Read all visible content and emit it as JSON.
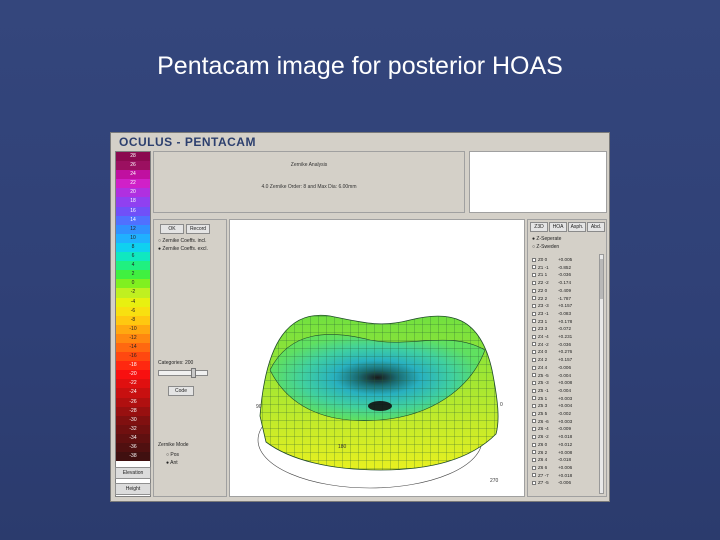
{
  "slide": {
    "title": "Pentacam image for posterior HOAS"
  },
  "app": {
    "title": "OCULUS - PENTACAM",
    "header_line1": "Zernike Analysis",
    "header_line2": "4.0 Zernike Order: 8 and Max Dia: 6.00mm",
    "scale_values": [
      "28",
      "26",
      "24",
      "22",
      "20",
      "18",
      "16",
      "14",
      "12",
      "10",
      "8",
      "6",
      "4",
      "2",
      "0",
      "-2",
      "-4",
      "-6",
      "-8",
      "-10",
      "-12",
      "-14",
      "-16",
      "-18",
      "-20",
      "-22",
      "-24",
      "-26",
      "-28",
      "-30",
      "-32",
      "-34",
      "-36",
      "-38"
    ],
    "scale_colors": [
      "#8b0a50",
      "#9b1060",
      "#c010a0",
      "#d020c8",
      "#b030e0",
      "#9040f0",
      "#7050f8",
      "#5070ff",
      "#3090ff",
      "#20b0ff",
      "#10d0f0",
      "#10e8c0",
      "#20f080",
      "#40f040",
      "#80f020",
      "#c0f020",
      "#e8f010",
      "#f8e010",
      "#ffc810",
      "#ffa810",
      "#ff8810",
      "#ff6810",
      "#ff4810",
      "#ff2810",
      "#f81010",
      "#e01010",
      "#c81010",
      "#b01010",
      "#981010",
      "#801010",
      "#701010",
      "#601010",
      "#501010",
      "#401010"
    ],
    "scale_buttons": [
      "Elevation",
      "Height"
    ],
    "controls": {
      "tabs": [
        "OK",
        "Record"
      ],
      "options": [
        "Zernike Coeffs. incl.",
        "Zernike Coeffs. excl."
      ],
      "slider_label": "Categories: 200",
      "code_button": "Code",
      "radio_title": "Zernike Mode",
      "radios": [
        "Pos",
        "Ant"
      ]
    },
    "right": {
      "tabs": [
        "Z3D",
        "HOA",
        "Asph.",
        "Abd."
      ],
      "mode_options": [
        "Z-Seperate",
        "Z-Sweden"
      ],
      "coefficients": [
        {
          "label": "Z0 0",
          "value": "+0.005"
        },
        {
          "label": "Z1 -1",
          "value": "-0.852"
        },
        {
          "label": "Z1 1",
          "value": "-0.036"
        },
        {
          "label": "Z2 -2",
          "value": "-0.174"
        },
        {
          "label": "Z2 0",
          "value": "-0.409"
        },
        {
          "label": "Z2 2",
          "value": "-1.787"
        },
        {
          "label": "Z3 -3",
          "value": "+0.157"
        },
        {
          "label": "Z3 -1",
          "value": "-0.083"
        },
        {
          "label": "Z3 1",
          "value": "+0.178"
        },
        {
          "label": "Z3 3",
          "value": "-0.072"
        },
        {
          "label": "Z4 -4",
          "value": "+0.231"
        },
        {
          "label": "Z4 -2",
          "value": "-0.036"
        },
        {
          "label": "Z4 0",
          "value": "+0.276"
        },
        {
          "label": "Z4 2",
          "value": "+0.157"
        },
        {
          "label": "Z4 4",
          "value": "-0.006"
        },
        {
          "label": "Z5 -5",
          "value": "-0.004"
        },
        {
          "label": "Z5 -3",
          "value": "+0.008"
        },
        {
          "label": "Z5 -1",
          "value": "-0.004"
        },
        {
          "label": "Z5 1",
          "value": "+0.003"
        },
        {
          "label": "Z5 3",
          "value": "+0.004"
        },
        {
          "label": "Z5 5",
          "value": "-0.002"
        },
        {
          "label": "Z6 -6",
          "value": "+0.003"
        },
        {
          "label": "Z6 -4",
          "value": "-0.009"
        },
        {
          "label": "Z6 -2",
          "value": "+0.018"
        },
        {
          "label": "Z6 0",
          "value": "+0.012"
        },
        {
          "label": "Z6 2",
          "value": "+0.008"
        },
        {
          "label": "Z6 4",
          "value": "-0.018"
        },
        {
          "label": "Z6 6",
          "value": "+0.006"
        },
        {
          "label": "Z7 -7",
          "value": "+0.018"
        },
        {
          "label": "Z7 -5",
          "value": "-0.006"
        }
      ]
    },
    "view_ticks": [
      "90",
      "0",
      "180",
      "270"
    ]
  }
}
